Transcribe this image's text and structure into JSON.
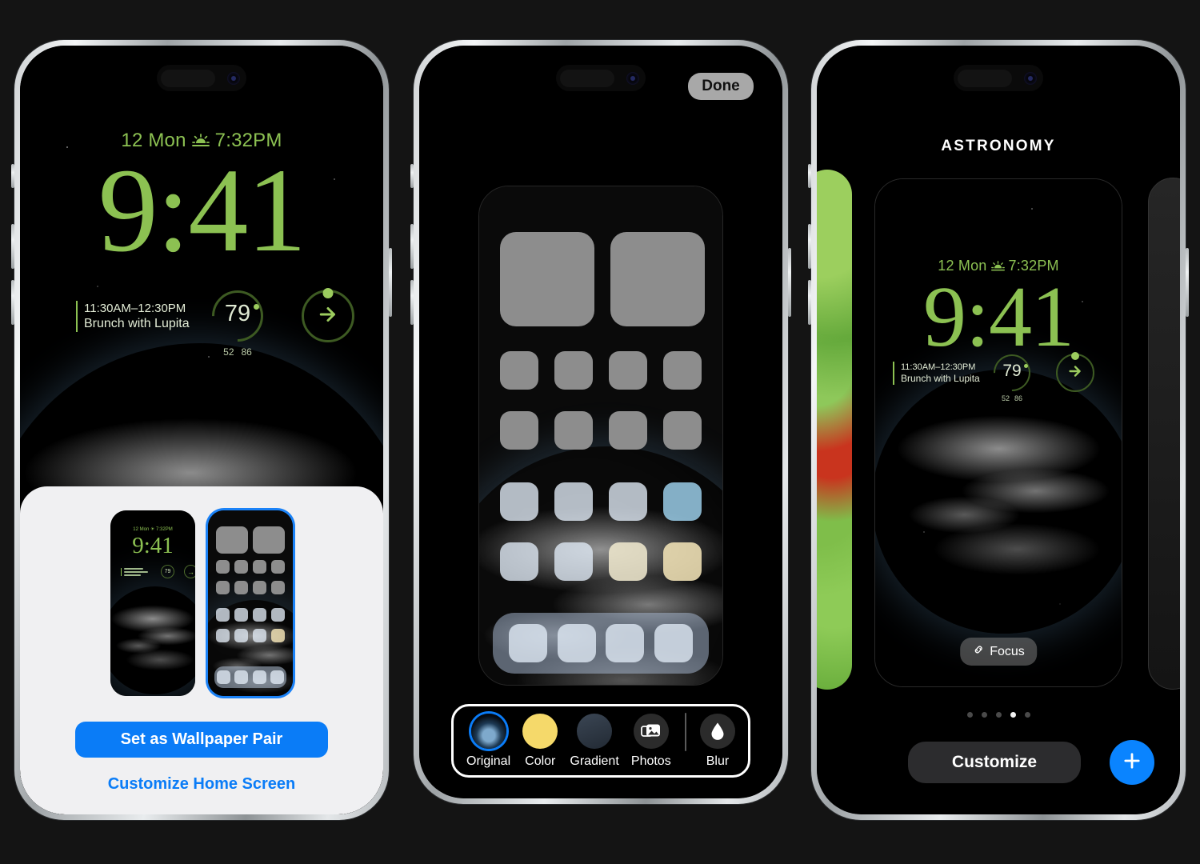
{
  "background_color": "#141414",
  "accent_blue": "#0a7cf7",
  "lock_green": "#8cc152",
  "lock_screen": {
    "date": "12 Mon",
    "weather_icon": "sunset-icon",
    "sunset_time": "7:32PM",
    "time": "9:41",
    "calendar_widget": {
      "time_range": "11:30AM–12:30PM",
      "title": "Brunch with Lupita"
    },
    "temperature_widget": {
      "value": "79",
      "low": "52",
      "high": "86"
    },
    "activity_widget": {
      "icon": "arrow-right-icon"
    }
  },
  "phone1": {
    "sheet": {
      "preview_lock_label": "lock-screen-preview",
      "preview_home_label": "home-screen-preview",
      "primary_button": "Set as Wallpaper Pair",
      "secondary_link": "Customize Home Screen"
    }
  },
  "phone2": {
    "done_button": "Done",
    "style_tray": {
      "items": [
        {
          "label": "Original",
          "icon": "original-photo-swatch",
          "selected": true
        },
        {
          "label": "Color",
          "icon": "color-swatch",
          "selected": false
        },
        {
          "label": "Gradient",
          "icon": "gradient-swatch",
          "selected": false
        },
        {
          "label": "Photos",
          "icon": "photos-icon",
          "selected": false
        },
        {
          "label": "Blur",
          "icon": "blur-drop-icon",
          "selected": false
        }
      ],
      "swatch_colors": {
        "color": "#f5d96a",
        "gradient": "#2f3a48",
        "photos_bg": "#2b2b2b",
        "blur_bg": "#2b2b2b"
      }
    }
  },
  "phone3": {
    "gallery_title": "ASTRONOMY",
    "focus_pill": {
      "icon": "link-icon",
      "label": "Focus"
    },
    "page_dots": {
      "count": 5,
      "active_index": 3
    },
    "customize_button": "Customize",
    "add_button": {
      "icon": "plus-icon",
      "label": "+"
    }
  }
}
